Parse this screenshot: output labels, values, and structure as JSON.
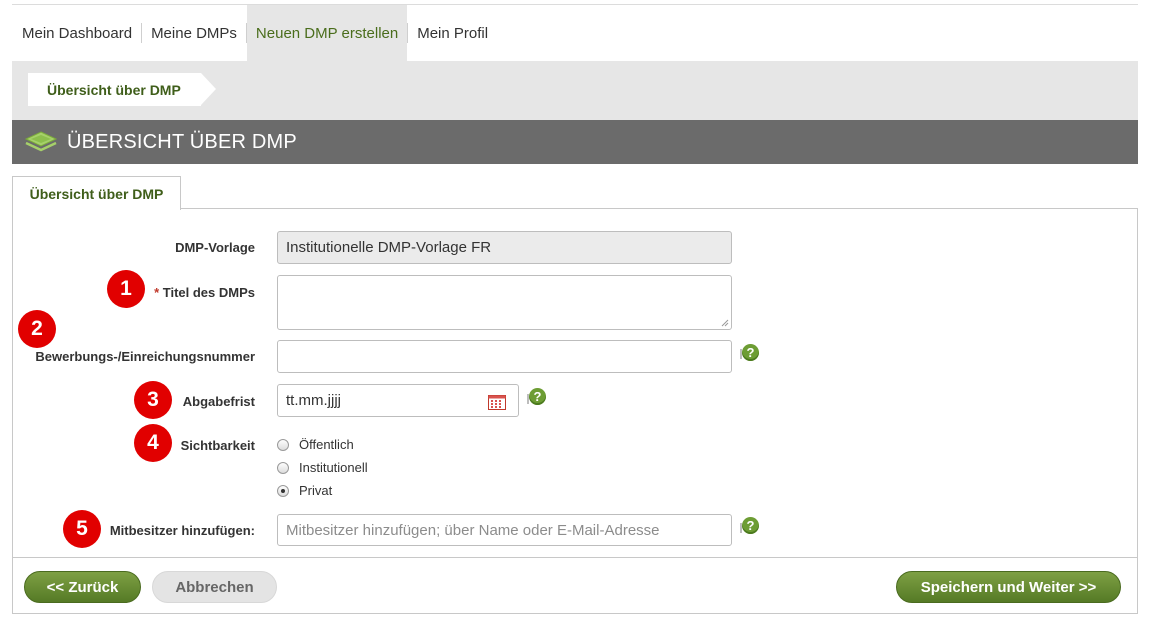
{
  "nav": {
    "items": [
      {
        "label": "Mein Dashboard"
      },
      {
        "label": "Meine DMPs"
      },
      {
        "label": "Neuen DMP erstellen",
        "active": true
      },
      {
        "label": "Mein Profil"
      }
    ]
  },
  "breadcrumb": {
    "current": "Übersicht über DMP"
  },
  "header": {
    "title": "ÜBERSICHT ÜBER DMP",
    "icon": "layers-icon"
  },
  "tab": {
    "label": "Übersicht über DMP"
  },
  "form": {
    "template": {
      "label": "DMP-Vorlage",
      "value": "Institutionelle DMP-Vorlage FR"
    },
    "title": {
      "required_mark": "*",
      "label": "Titel des DMPs",
      "value": ""
    },
    "grant_number": {
      "label": "Bewerbungs-/Einreichungsnummer",
      "value": "",
      "help": "?"
    },
    "deadline": {
      "label": "Abgabefrist",
      "value": "tt.mm.jjjj",
      "icon": "calendar-icon",
      "help": "?"
    },
    "visibility": {
      "label": "Sichtbarkeit",
      "options": [
        {
          "label": "Öffentlich",
          "checked": false
        },
        {
          "label": "Institutionell",
          "checked": false
        },
        {
          "label": "Privat",
          "checked": true
        }
      ]
    },
    "co_owners": {
      "label": "Mitbesitzer hinzufügen:",
      "placeholder": "Mitbesitzer hinzufügen; über Name oder E-Mail-Adresse",
      "help": "?"
    }
  },
  "badges": [
    "1",
    "2",
    "3",
    "4",
    "5"
  ],
  "buttons": {
    "back": "<< Zurück",
    "cancel": "Abbrechen",
    "save": "Speichern und Weiter >>"
  },
  "colors": {
    "accent_green": "#557a26",
    "header_grey": "#6b6b6b",
    "badge_red": "#e10000"
  }
}
